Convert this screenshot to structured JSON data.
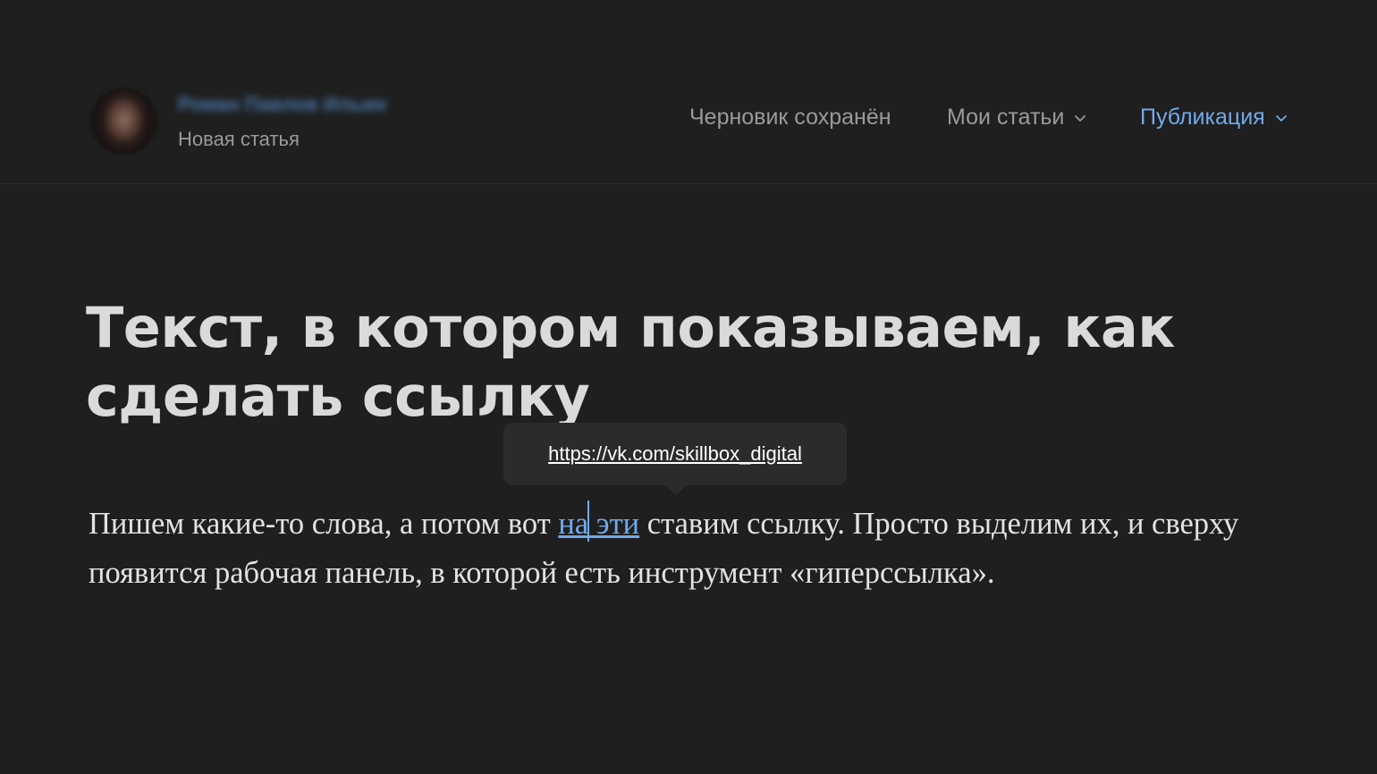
{
  "header": {
    "author_name": "Роман Павлов Ильин",
    "doc_type": "Новая статья",
    "draft_status": "Черновик сохранён",
    "my_articles_label": "Мои статьи",
    "publish_label": "Публикация"
  },
  "article": {
    "title": "Текст, в котором показываем, как сделать ссылку",
    "paragraph_before": "Пишем какие-то слова, а потом вот ",
    "link_part1": "на",
    "link_part2": " эти",
    "paragraph_after": " ставим ссылку. Просто выделим их, и сверху появится рабочая панель, в которой есть инструмент «гиперссылка»."
  },
  "link_tooltip": {
    "url": "https://vk.com/skillbox_digital"
  },
  "colors": {
    "background": "#1f1f1f",
    "accent": "#71aaeb",
    "muted_text": "#9a9a9a",
    "tooltip_bg": "#2b2b2c"
  }
}
